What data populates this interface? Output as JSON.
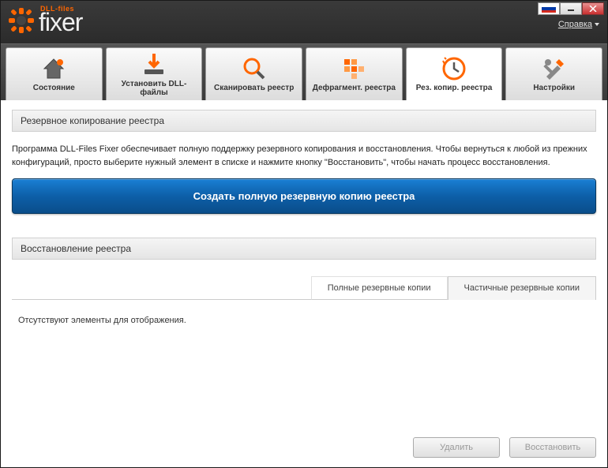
{
  "brand": {
    "sub": "DLL-files",
    "main": "fixer"
  },
  "titlebar": {
    "help": "Справка"
  },
  "tabs": [
    {
      "id": "status",
      "label": "Состояние"
    },
    {
      "id": "install",
      "label": "Установить DLL-файлы"
    },
    {
      "id": "scan",
      "label": "Сканировать реестр"
    },
    {
      "id": "defrag",
      "label": "Дефрагмент. реестра"
    },
    {
      "id": "backup",
      "label": "Рез. копир. реестра"
    },
    {
      "id": "settings",
      "label": "Настройки"
    }
  ],
  "sections": {
    "backup_title": "Резервное копирование реестра",
    "backup_desc": "Программа DLL-Files Fixer обеспечивает полную поддержку резервного копирования и восстановления. Чтобы вернуться к любой из прежних конфигураций, просто выберите нужный элемент в списке и нажмите кнопку \"Восстановить\", чтобы начать процесс восстановления.",
    "create_backup_btn": "Создать полную резервную копию реестра",
    "restore_title": "Восстановление реестра"
  },
  "sub_tabs": {
    "full": "Полные резервные копии",
    "partial": "Частичные резервные копии"
  },
  "list": {
    "empty": "Отсутствуют элементы для отображения."
  },
  "buttons": {
    "delete": "Удалить",
    "restore": "Восстановить"
  }
}
